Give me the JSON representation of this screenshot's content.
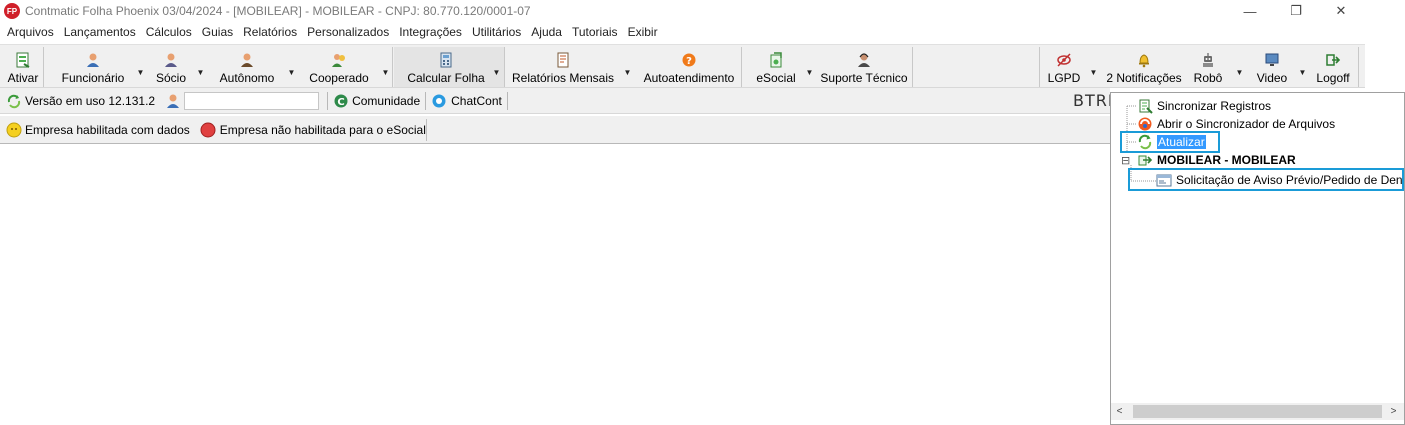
{
  "window": {
    "logo_text": "FP",
    "title": "Contmatic Folha Phoenix 03/04/2024 - [MOBILEAR] - MOBILEAR - CNPJ: 80.770.120/0001-07",
    "minimize": "—",
    "maximize": "❐",
    "close": "✕"
  },
  "menu": [
    "Arquivos",
    "Lançamentos",
    "Cálculos",
    "Guias",
    "Relatórios",
    "Personalizados",
    "Integrações",
    "Utilitários",
    "Ajuda",
    "Tutoriais",
    "Exibir"
  ],
  "toolbar": {
    "ativar": "Ativar",
    "funcionario": "Funcionário",
    "socio": "Sócio",
    "autonomo": "Autônomo",
    "cooperado": "Cooperado",
    "calcular_folha": "Calcular Folha",
    "relatorios_mensais": "Relatórios Mensais",
    "autoatendimento": "Autoatendimento",
    "esocial": "eSocial",
    "suporte_tecnico": "Suporte Técnico",
    "lgpd": "LGPD",
    "notificacoes": "2 Notificações",
    "robo": "Robô",
    "video": "Video",
    "logoff": "Logoff",
    "dropdown_glyph": "▼"
  },
  "statusbar": {
    "version": "Versão em uso 12.131.2",
    "user_value": "",
    "comunidade": "Comunidade",
    "chatcont": "ChatCont",
    "brand": "BTRIE"
  },
  "badges": {
    "habilitada": "Empresa habilitada com dados",
    "nao_habilitada": "Empresa não habilitada para o eSocial"
  },
  "tree": {
    "sincronizar": "Sincronizar Registros",
    "abrir_sincronizador": "Abrir o Sincronizador de Arquivos",
    "atualizar": "Atualizar",
    "company": "MOBILEAR - MOBILEAR",
    "expander": "⊟",
    "solicitacao": "Solicitação de Aviso Prévio/Pedido de Den"
  },
  "scrollbar": {
    "left": "<",
    "right": ">"
  },
  "colors": {
    "highlight_border": "#1a9bd7",
    "selection": "#3399ff",
    "logo_red": "#d0202a"
  }
}
